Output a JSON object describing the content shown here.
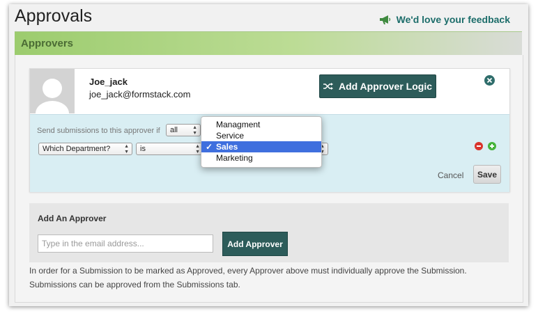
{
  "page": {
    "title": "Approvals",
    "feedback_label": "We'd love your feedback"
  },
  "section": {
    "title": "Approvers"
  },
  "approver": {
    "name": "Joe_jack",
    "email": "joe_jack@formstack.com",
    "logic_button_label": "Add Approver Logic"
  },
  "logic": {
    "send_label": "Send submissions to this approver if",
    "match_select": "all",
    "field_select": "Which Department?",
    "operator_select": "is",
    "value_options": [
      "Managment",
      "Service",
      "Sales",
      "Marketing"
    ],
    "value_selected_index": 2,
    "cancel_label": "Cancel",
    "save_label": "Save"
  },
  "add_approver": {
    "title": "Add An Approver",
    "email_placeholder": "Type in the email address...",
    "button_label": "Add Approver"
  },
  "info_text": "In order for a Submission to be marked as Approved, every Approver above must individually approve the Submission. Submissions can be approved from the Submissions tab.",
  "colors": {
    "accent": "#2d5c5a",
    "header_green": "#9ccc6e",
    "panel_blue": "#d9eef3",
    "selected_blue": "#3f6fde"
  },
  "icons": [
    "megaphone-icon",
    "shuffle-icon",
    "close-icon",
    "remove-condition-icon",
    "add-condition-icon",
    "checkmark-icon"
  ]
}
